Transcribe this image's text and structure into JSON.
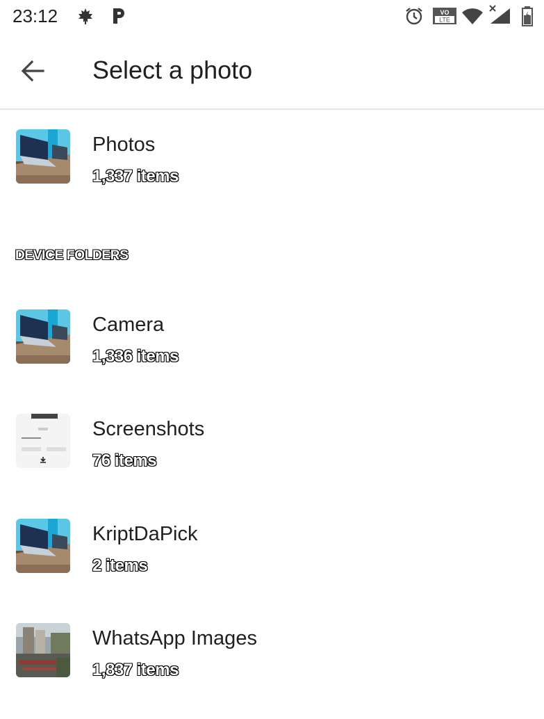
{
  "status_bar": {
    "time": "23:12",
    "left_icons": [
      "leaf-icon",
      "parking-icon"
    ],
    "right_icons": [
      "alarm-icon",
      "volte-icon",
      "wifi-icon",
      "signal-icon",
      "battery-icon"
    ],
    "volte_top": "VO",
    "volte_bottom": "LTE"
  },
  "app_bar": {
    "back_icon": "arrow-back-icon",
    "title": "Select a photo"
  },
  "albums": [
    {
      "name": "Photos",
      "count": "1,337 items",
      "thumbnail": "laptop-photo"
    }
  ],
  "device_folders": {
    "header": "DEVICE FOLDERS",
    "items": [
      {
        "name": "Camera",
        "count": "1,336 items",
        "thumbnail": "laptop-photo"
      },
      {
        "name": "Screenshots",
        "count": "76 items",
        "thumbnail": "screenshot"
      },
      {
        "name": "KriptDaPick",
        "count": "2 items",
        "thumbnail": "laptop-photo"
      },
      {
        "name": "WhatsApp Images",
        "count": "1,837 items",
        "thumbnail": "city-photo"
      }
    ]
  }
}
